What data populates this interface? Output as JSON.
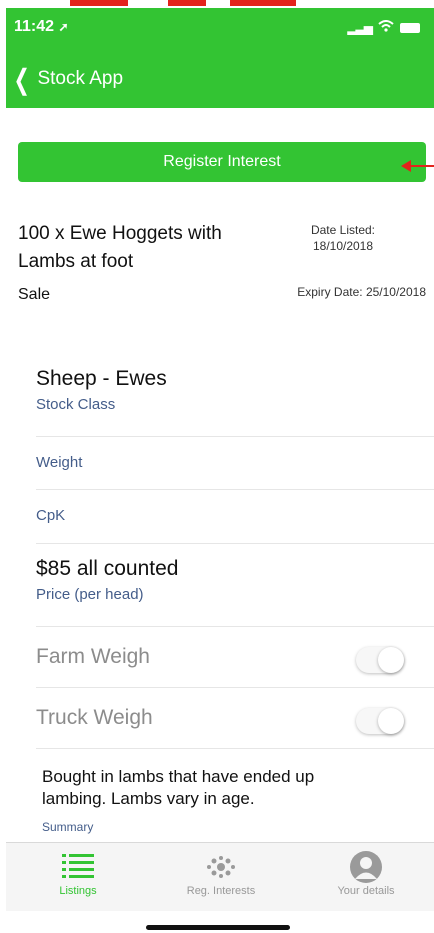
{
  "status_bar": {
    "time": "11:42",
    "time_icon": "location-arrow-icon"
  },
  "nav": {
    "back_label": "Stock App"
  },
  "register_button": "Register Interest",
  "listing": {
    "title": "100 x Ewe Hoggets with Lambs at foot",
    "date_listed_label": "Date Listed:",
    "date_listed": "18/10/2018",
    "sale_type": "Sale",
    "expiry": "Expiry Date: 25/10/2018"
  },
  "fields": {
    "stock_class_value": "Sheep - Ewes",
    "stock_class_label": "Stock Class",
    "weight_label": "Weight",
    "cpk_label": "CpK",
    "price_value": "$85 all counted",
    "price_label": "Price (per head)",
    "farm_weigh_label": "Farm Weigh",
    "truck_weigh_label": "Truck Weigh"
  },
  "summary": {
    "text": "Bought in lambs that have ended up lambing. Lambs vary in age.",
    "label": "Summary"
  },
  "tabs": [
    {
      "label": "Listings",
      "icon": "list-icon",
      "active": true
    },
    {
      "label": "Reg. Interests",
      "icon": "interests-icon",
      "active": false
    },
    {
      "label": "Your details",
      "icon": "user-avatar-icon",
      "active": false
    }
  ],
  "colors": {
    "accent": "#33c433",
    "annotation": "#e3231c",
    "secondary_text": "#445d8a"
  }
}
